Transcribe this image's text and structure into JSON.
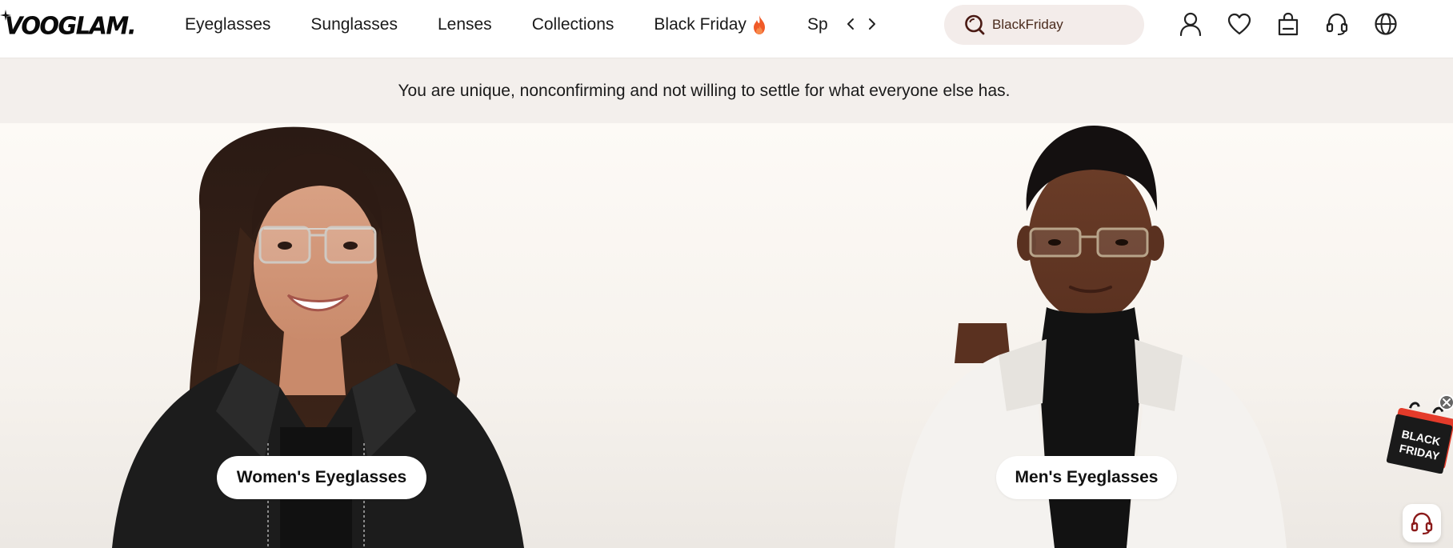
{
  "brand": {
    "logo_text": "VOOGLAM."
  },
  "nav": {
    "items": [
      {
        "label": "Eyeglasses"
      },
      {
        "label": "Sunglasses"
      },
      {
        "label": "Lenses"
      },
      {
        "label": "Collections"
      },
      {
        "label": "Black Friday",
        "icon": "fire-icon"
      },
      {
        "label": "Sp"
      }
    ],
    "prev_icon": "chevron-left-icon",
    "next_icon": "chevron-right-icon"
  },
  "search": {
    "value": "BlackFriday",
    "icon": "search-icon"
  },
  "header_icons": [
    "account-icon",
    "wishlist-heart-icon",
    "cart-bag-icon",
    "support-headset-icon",
    "language-globe-icon"
  ],
  "banner": {
    "heading": "",
    "subtitle": "You are unique, nonconfirming and not willing to settle for what everyone else has."
  },
  "categories": [
    {
      "label": "Women's Eyeglasses"
    },
    {
      "label": "Men's Eyeglasses"
    }
  ],
  "floating": {
    "black_friday_badge": "BLACK FRIDAY",
    "close_icon": "close-icon",
    "support_icon": "support-headset-icon"
  },
  "colors": {
    "accent_fire": "#f05a28",
    "search_bg": "#f3ecea",
    "banner_bg": "#f3efec",
    "support_red": "#8b1a1a"
  }
}
